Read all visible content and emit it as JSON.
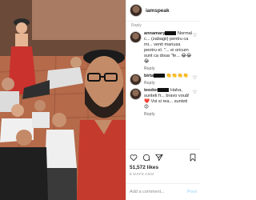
{
  "post": {
    "username": "iamspeak",
    "likes": "51,572 likes",
    "date": "6 DAYS AGO"
  },
  "first_comment_reply": "Reply",
  "comments": [
    {
      "username": "annamary",
      "text": "Normal c... (zabagii) pentru ca mi... venit manusa pentru el. \"... ei oricum sunt ca doua \"fe...",
      "emoji": "😂😂😂",
      "reply": "Reply"
    },
    {
      "username": "birta",
      "text": "",
      "emoji": "👏👏👏👏",
      "reply": "Reply"
    },
    {
      "username": "teodor",
      "text": "Haha, sunteti fr... bravo vouă! ❤️ Voi si rea... sunteti",
      "emoji": "😍",
      "reply": "Reply"
    }
  ],
  "add_comment": {
    "placeholder": "Add a comment...",
    "post_label": "Post"
  },
  "icons": [
    "heart-icon",
    "comment-icon",
    "share-icon",
    "bookmark-icon"
  ],
  "colors": {
    "accent": "#0095f6",
    "muted": "#8e8e8e"
  }
}
